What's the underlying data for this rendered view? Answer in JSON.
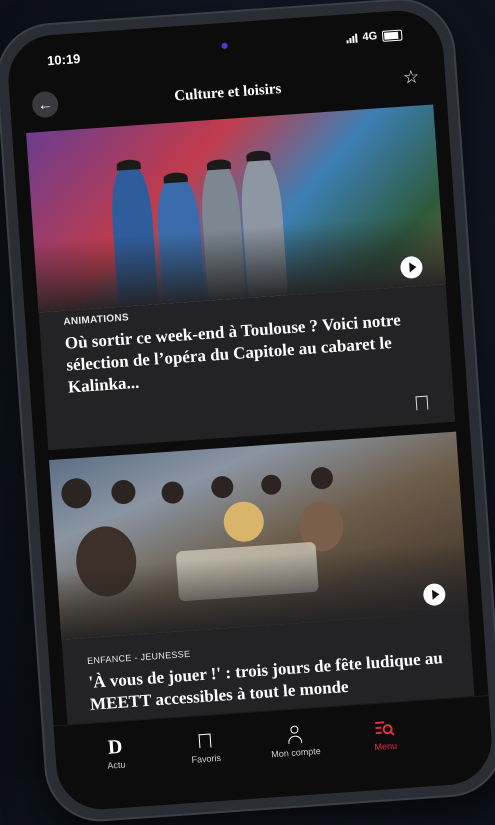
{
  "status_bar": {
    "time": "10:19",
    "network": "4G"
  },
  "header": {
    "title": "Culture et loisirs"
  },
  "articles": [
    {
      "category": "ANIMATIONS",
      "title": "Où sortir ce week-end à Toulouse ? Voici notre sélection de l’opéra du Capitole au cabaret le Kalinka..."
    },
    {
      "category": "ENFANCE - JEUNESSE",
      "title": "'À vous de jouer !' : trois jours de fête ludique au MEETT accessibles à tout le monde"
    }
  ],
  "tabbar": {
    "items": [
      {
        "label": "Actu",
        "icon": "d-logo-icon",
        "glyph": "D"
      },
      {
        "label": "Favoris",
        "icon": "bookmark-icon"
      },
      {
        "label": "Mon compte",
        "icon": "person-icon"
      },
      {
        "label": "Menu",
        "icon": "menu-search-icon",
        "active": true
      }
    ]
  },
  "colors": {
    "accent": "#e0303d",
    "background": "#0c0c0d",
    "card": "#232325"
  }
}
